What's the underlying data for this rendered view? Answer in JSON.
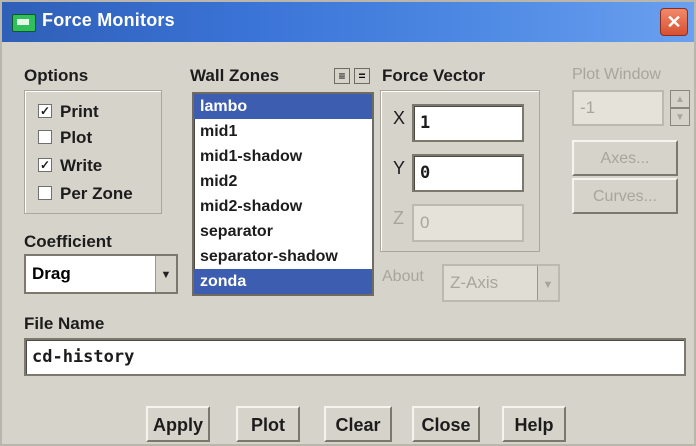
{
  "window": {
    "title": "Force Monitors",
    "close_glyph": "✕"
  },
  "options": {
    "label": "Options",
    "items": [
      {
        "label": "Print",
        "checked": true
      },
      {
        "label": "Plot",
        "checked": false
      },
      {
        "label": "Write",
        "checked": true
      },
      {
        "label": "Per Zone",
        "checked": false
      }
    ]
  },
  "wall_zones": {
    "label": "Wall Zones",
    "select_all_glyph": "≡",
    "deselect_glyph": "=",
    "items": [
      {
        "label": "lambo",
        "selected": true
      },
      {
        "label": "mid1",
        "selected": false
      },
      {
        "label": "mid1-shadow",
        "selected": false
      },
      {
        "label": "mid2",
        "selected": false
      },
      {
        "label": "mid2-shadow",
        "selected": false
      },
      {
        "label": "separator",
        "selected": false
      },
      {
        "label": "separator-shadow",
        "selected": false
      },
      {
        "label": "zonda",
        "selected": true
      }
    ]
  },
  "force_vector": {
    "label": "Force Vector",
    "x_label": "X",
    "x_value": "1",
    "y_label": "Y",
    "y_value": "0",
    "z_label": "Z",
    "z_value": "0"
  },
  "about": {
    "label": "About",
    "value": "Z-Axis"
  },
  "coefficient": {
    "label": "Coefficient",
    "value": "Drag",
    "arrow_glyph": "▼"
  },
  "plot_window": {
    "label": "Plot Window",
    "value": "-1",
    "up_glyph": "▲",
    "down_glyph": "▼"
  },
  "axes_button": "Axes...",
  "curves_button": "Curves...",
  "file_name": {
    "label": "File Name",
    "value": "cd-history"
  },
  "buttons": {
    "apply": "Apply",
    "plot": "Plot",
    "clear": "Clear",
    "close": "Close",
    "help": "Help"
  }
}
